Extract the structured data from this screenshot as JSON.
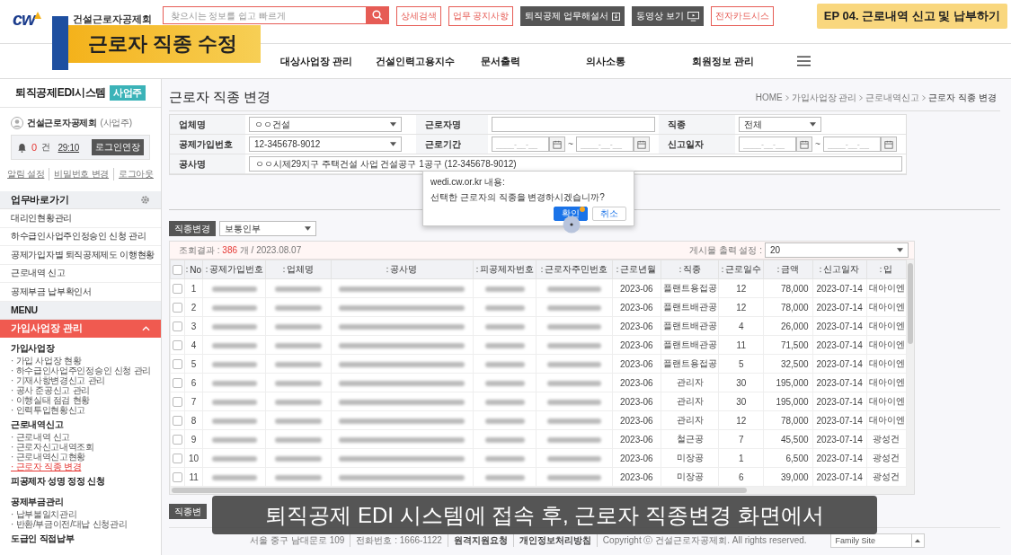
{
  "header": {
    "logo_mark": "cw",
    "logo_text": "건설근로자공제회",
    "search": {
      "placeholder": "찾으시는 정보를 쉽고 빠르게"
    },
    "buttons": [
      {
        "label": "상세검색",
        "kind": "outline"
      },
      {
        "label": "업무 공지사항",
        "kind": "outline"
      },
      {
        "label": "퇴직공제 업무해설서",
        "kind": "download"
      },
      {
        "label": "동영상 보기",
        "kind": "video"
      },
      {
        "label": "전자카드시스",
        "kind": "outline"
      }
    ]
  },
  "nav": [
    "대상사업장 관리",
    "건설인력고용지수",
    "문서출력",
    "의사소통",
    "회원정보 관리"
  ],
  "overlay_title": "근로자 직종 수정",
  "episode_badge": "EP 04. 근로내역 신고 및 납부하기",
  "sidebar": {
    "title": "퇴직공제EDI시스템",
    "badge": "사업주",
    "user": {
      "name": "건설근로자공제회",
      "role": "(사업주)",
      "alert_count": "0",
      "alert_unit": "건",
      "timer": "29:10",
      "extend_button": "로그인연장",
      "links": [
        "알림 설정",
        "비밀번호 변경",
        "로그아웃"
      ]
    },
    "shortcuts_title": "업무바로가기",
    "shortcuts": [
      "대리인현황관리",
      "하수급인사업주인정승인 신청 관리",
      "공제가입자별 퇴직공제제도 이행현황",
      "근로내역 신고",
      "공제부금 납부확인서"
    ],
    "menu_label": "MENU",
    "menu": [
      {
        "label": "가입사업장 관리",
        "expanded": true,
        "groups": [
          {
            "label": "가입사업장",
            "children": [
              {
                "label": "· 가입 사업장 현황",
                "selected": false
              },
              {
                "label": "· 하수급인사업주인정승인 신청 관리",
                "selected": false
              },
              {
                "label": "· 기재사항변경신고 관리",
                "selected": false
              },
              {
                "label": "· 공사 준공신고 관리",
                "selected": false
              },
              {
                "label": "· 이행실태 점검 현황",
                "selected": false
              },
              {
                "label": "· 인력투입현황신고",
                "selected": false
              }
            ]
          },
          {
            "label": "근로내역신고",
            "children": [
              {
                "label": "· 근로내역 신고",
                "selected": false
              },
              {
                "label": "· 근로자신고내역조회",
                "selected": false
              },
              {
                "label": "· 근로내역신고현황",
                "selected": false
              },
              {
                "label": "· 근로자 직종 변경",
                "selected": true
              }
            ]
          },
          {
            "label": "피공제자 성명 정정 신청"
          },
          {
            "label": "공제부금관리",
            "children": [
              {
                "label": "· 납부불일치관리",
                "selected": false
              },
              {
                "label": "· 반환/부금이전/대납 신청관리",
                "selected": false
              }
            ]
          },
          {
            "label": "도급인 직접납부"
          }
        ]
      }
    ]
  },
  "page": {
    "title": "근로자 직종 변경",
    "breadcrumb": [
      "HOME",
      "가입사업장 관리",
      "근로내역신고",
      "근로자 직종 변경"
    ]
  },
  "filters": [
    [
      {
        "label": "업체명",
        "kind": "select",
        "value": "ㅇㅇ건설"
      },
      {
        "label": "근로자명",
        "kind": "text"
      },
      {
        "label": "직종",
        "kind": "select",
        "value": "전체"
      }
    ],
    [
      {
        "label": "공제가입번호",
        "kind": "select",
        "value": "12-345678-9012"
      },
      {
        "label": "근로기간",
        "kind": "date-range",
        "placeholder": "____-__-__",
        "separator": "~"
      },
      {
        "label": "신고일자",
        "kind": "date-range",
        "placeholder": "____-__-__",
        "separator": "~"
      }
    ],
    [
      {
        "label": "공사명",
        "kind": "wide-text",
        "value": "ㅇㅇ시제29지구 주택건설 사업 건설공구 1공구 (12-345678-9012)"
      }
    ]
  ],
  "dialog": {
    "title": "wedi.cw.or.kr 내용:",
    "message": "선택한 근로자의 직종을 변경하시겠습니까?",
    "buttons": [
      {
        "label": "확인",
        "selected": true
      },
      {
        "label": "취소",
        "selected": false
      }
    ]
  },
  "toolbar": {
    "button": "직종변경",
    "select": "보통인부"
  },
  "results": {
    "label": "조회결과 :",
    "count": "386",
    "suffix": "개 / 2023.08.07",
    "page_size_label": "게시물 출력 설정 :",
    "page_size": "20"
  },
  "table": {
    "select_all": false,
    "columns": [
      {
        "label": "No",
        "kind": "text"
      },
      {
        "label": "공제가입번호",
        "kind": "blurred"
      },
      {
        "label": "업체명",
        "kind": "blurred"
      },
      {
        "label": "공사명",
        "kind": "blurred"
      },
      {
        "label": "피공제자번호",
        "kind": "blurred"
      },
      {
        "label": "근로자주민번호",
        "kind": "blurred"
      },
      {
        "label": "근로년월",
        "kind": "text"
      },
      {
        "label": "직종",
        "kind": "text"
      },
      {
        "label": "근로일수",
        "kind": "text"
      },
      {
        "label": "금액",
        "kind": "number"
      },
      {
        "label": "신고일자",
        "kind": "text"
      },
      {
        "label": "입",
        "kind": "text"
      }
    ],
    "rows": [
      {
        "checked": false,
        "cells": [
          "1",
          "",
          "",
          "",
          "",
          "",
          "2023-06",
          "플랜트용접공",
          "12",
          "78,000",
          "2023-07-14",
          "대아이엔"
        ]
      },
      {
        "checked": false,
        "cells": [
          "2",
          "",
          "",
          "",
          "",
          "",
          "2023-06",
          "플랜트배관공",
          "12",
          "78,000",
          "2023-07-14",
          "대아이엔"
        ]
      },
      {
        "checked": false,
        "cells": [
          "3",
          "",
          "",
          "",
          "",
          "",
          "2023-06",
          "플랜트배관공",
          "4",
          "26,000",
          "2023-07-14",
          "대아이엔"
        ]
      },
      {
        "checked": false,
        "cells": [
          "4",
          "",
          "",
          "",
          "",
          "",
          "2023-06",
          "플랜트배관공",
          "11",
          "71,500",
          "2023-07-14",
          "대아이엔"
        ]
      },
      {
        "checked": false,
        "cells": [
          "5",
          "",
          "",
          "",
          "",
          "",
          "2023-06",
          "플랜트용접공",
          "5",
          "32,500",
          "2023-07-14",
          "대아이엔"
        ]
      },
      {
        "checked": false,
        "cells": [
          "6",
          "",
          "",
          "",
          "",
          "",
          "2023-06",
          "관리자",
          "30",
          "195,000",
          "2023-07-14",
          "대아이엔"
        ]
      },
      {
        "checked": false,
        "cells": [
          "7",
          "",
          "",
          "",
          "",
          "",
          "2023-06",
          "관리자",
          "30",
          "195,000",
          "2023-07-14",
          "대아이엔"
        ]
      },
      {
        "checked": false,
        "cells": [
          "8",
          "",
          "",
          "",
          "",
          "",
          "2023-06",
          "관리자",
          "12",
          "78,000",
          "2023-07-14",
          "대아이엔"
        ]
      },
      {
        "checked": false,
        "cells": [
          "9",
          "",
          "",
          "",
          "",
          "",
          "2023-06",
          "철근공",
          "7",
          "45,500",
          "2023-07-14",
          "광성건"
        ]
      },
      {
        "checked": false,
        "cells": [
          "10",
          "",
          "",
          "",
          "",
          "",
          "2023-06",
          "미장공",
          "1",
          "6,500",
          "2023-07-14",
          "광성건"
        ]
      },
      {
        "checked": false,
        "cells": [
          "11",
          "",
          "",
          "",
          "",
          "",
          "2023-06",
          "미장공",
          "6",
          "39,000",
          "2023-07-14",
          "광성건"
        ]
      }
    ]
  },
  "bottom_button": "직종변",
  "caption": "퇴직공제 EDI 시스템에 접속 후, 근로자 직종변경 화면에서",
  "footer": {
    "items": [
      {
        "text": "서울 중구 남대문로 109",
        "bold": false
      },
      {
        "text": "전화번호 : 1666-1122",
        "bold": false
      },
      {
        "text": "원격지원요청",
        "bold": true
      },
      {
        "text": "개인정보처리방침",
        "bold": true
      },
      {
        "text": "Copyright ⓒ 건설근로자공제회. All rights reserved.",
        "bold": false
      }
    ],
    "family_site": "Family Site"
  }
}
